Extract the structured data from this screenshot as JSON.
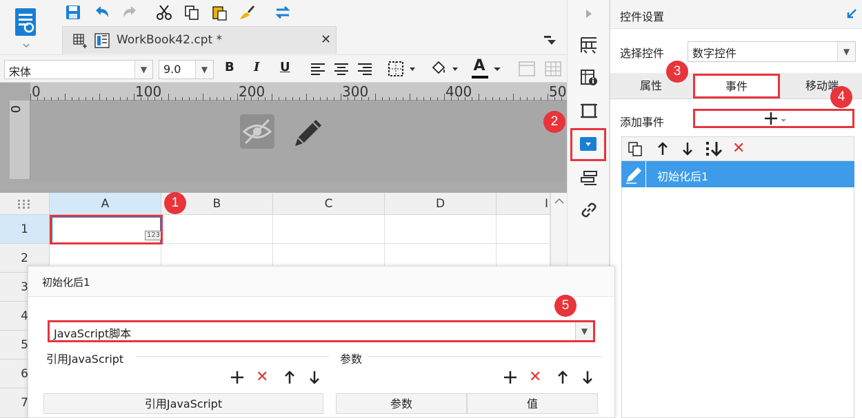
{
  "document": {
    "tab_title": "WorkBook42.cpt *"
  },
  "format_bar": {
    "font_name": "宋体",
    "font_size": "9.0",
    "bold_label": "B",
    "italic_label": "I",
    "underline_label": "U",
    "font_color_label": "A"
  },
  "ruler": {
    "labels": [
      "0",
      "100",
      "200",
      "300",
      "400",
      "50"
    ],
    "left_label": "0"
  },
  "grid": {
    "columns": [
      "A",
      "B",
      "C",
      "D",
      "I"
    ],
    "rows": [
      "1",
      "2",
      "3",
      "4",
      "5",
      "6",
      "7"
    ],
    "cell_widget_text": "123"
  },
  "panel": {
    "title": "控件设置",
    "select_widget_label": "选择控件",
    "select_widget_value": "数字控件",
    "tabs": [
      "属性",
      "事件",
      "移动端"
    ],
    "add_event_label": "添加事件",
    "events": [
      "初始化后1"
    ]
  },
  "dialog": {
    "title": "初始化后1",
    "script_type": "JavaScript脚本",
    "ref_js_section": "引用JavaScript",
    "params_section": "参数",
    "ref_js_column": "引用JavaScript",
    "param_columns": [
      "参数",
      "值"
    ]
  },
  "badges": [
    "1",
    "2",
    "3",
    "4",
    "5"
  ],
  "colors": {
    "highlight_red": "#e8343b",
    "selected_blue": "#3d9be9",
    "accent_blue": "#1a7fd4"
  }
}
